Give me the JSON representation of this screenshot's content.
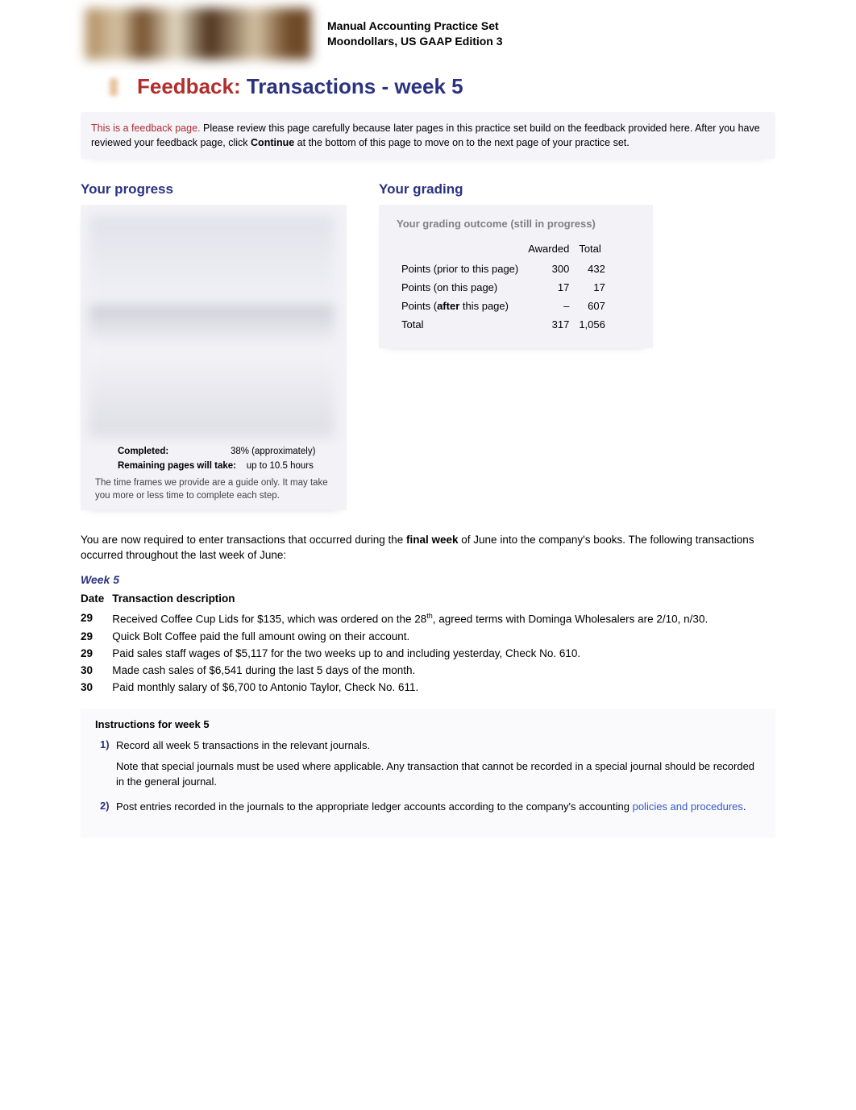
{
  "banner": {
    "line1": "Manual Accounting Practice Set",
    "line2": "Moondollars, US GAAP Edition 3"
  },
  "title": {
    "prefix": "Feedback:",
    "rest": "Transactions - week 5"
  },
  "infobox": {
    "red_prefix": "This is a feedback page.",
    "text_before_bold": "Please review this page carefully because later pages in this practice set build on the feedback provided here. After you have reviewed your feedback page, click ",
    "bold_word": "Continue",
    "text_after_bold": " at the bottom of this page to move on to the next page of your practice set."
  },
  "progress": {
    "heading": "Your progress",
    "completed_label": "Completed:",
    "completed_value": "38% (approximately)",
    "remaining_label": "Remaining pages will take:",
    "remaining_value": "up to 10.5 hours",
    "note": "The time frames we provide are a guide only. It may take you more or less time to complete each step."
  },
  "grading": {
    "heading": "Your grading",
    "subheading": "Your grading outcome (still in progress)",
    "col_awarded": "Awarded",
    "col_total": "Total",
    "rows": [
      {
        "label_pre": "Points (prior to this page)",
        "label_bold": "",
        "label_post": "",
        "awarded": "300",
        "total": "432"
      },
      {
        "label_pre": "Points (on this page)",
        "label_bold": "",
        "label_post": "",
        "awarded": "17",
        "total": "17"
      },
      {
        "label_pre": "Points (",
        "label_bold": "after",
        "label_post": " this page)",
        "awarded": "–",
        "total": "607"
      },
      {
        "label_pre": "Total",
        "label_bold": "",
        "label_post": "",
        "awarded": "317",
        "total": "1,056"
      }
    ]
  },
  "body_intro_pre": "You are now required to enter transactions that occurred during the ",
  "body_intro_bold": "final week",
  "body_intro_post": " of June into the company's books. The following transactions occurred throughout the last week of June:",
  "week_heading": "Week 5",
  "tx_header_date": "Date",
  "tx_header_desc": "Transaction description",
  "transactions": [
    {
      "date": "29",
      "desc_pre": "Received Coffee Cup Lids for $135, which was ordered on the 28",
      "sup": "th",
      "desc_post": ", agreed terms with Dominga Wholesalers are 2/10, n/30."
    },
    {
      "date": "29",
      "desc_pre": "Quick Bolt Coffee paid the full amount owing on their account.",
      "sup": "",
      "desc_post": ""
    },
    {
      "date": "29",
      "desc_pre": "Paid sales staff wages of $5,117 for the two weeks up to and including yesterday, Check No. 610.",
      "sup": "",
      "desc_post": ""
    },
    {
      "date": "30",
      "desc_pre": "Made cash sales of $6,541 during the last 5 days of the month.",
      "sup": "",
      "desc_post": ""
    },
    {
      "date": "30",
      "desc_pre": "Paid monthly salary of $6,700 to Antonio Taylor, Check No. 611.",
      "sup": "",
      "desc_post": ""
    }
  ],
  "instructions": {
    "heading": "Instructions for week 5",
    "items": [
      {
        "num": "1",
        "line1": "Record all week 5 transactions in the relevant journals.",
        "line2": "Note that special journals must be used where applicable. Any transaction that cannot be recorded in a special journal should be recorded in the general journal.",
        "link_text": ""
      },
      {
        "num": "2",
        "line1_pre": "Post entries recorded in the journals to the appropriate ledger accounts according to the company's accounting ",
        "link_text": "policies and procedures",
        "line1_post": "."
      }
    ]
  }
}
